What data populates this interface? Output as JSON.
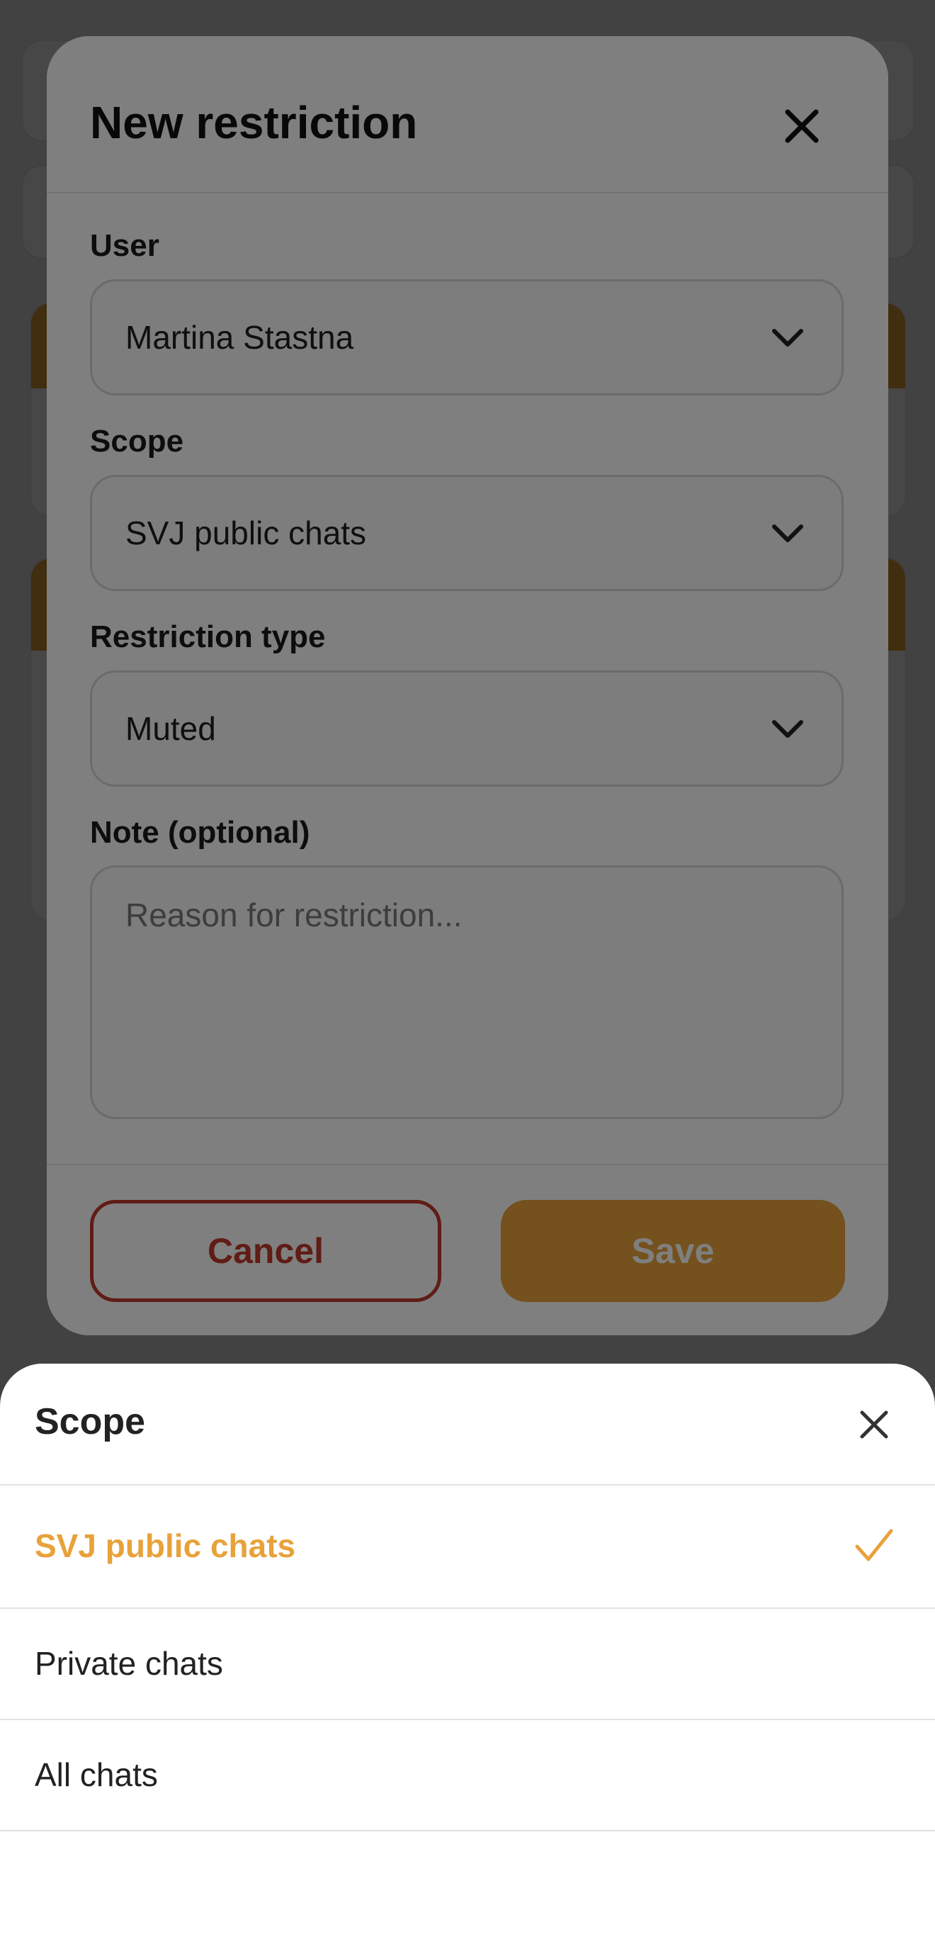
{
  "modal": {
    "title": "New restriction",
    "fields": {
      "user_label": "User",
      "user_value": "Martina Stastna",
      "scope_label": "Scope",
      "scope_value": "SVJ public chats",
      "type_label": "Restriction type",
      "type_value": "Muted",
      "note_label": "Note (optional)",
      "note_placeholder": "Reason for restriction..."
    },
    "buttons": {
      "cancel": "Cancel",
      "save": "Save"
    }
  },
  "sheet": {
    "title": "Scope",
    "options": [
      {
        "label": "SVJ public chats",
        "selected": true
      },
      {
        "label": "Private chats",
        "selected": false
      },
      {
        "label": "All chats",
        "selected": false
      }
    ]
  },
  "colors": {
    "accent": "#e8a23a",
    "danger": "#c0392b"
  },
  "icons": {
    "modal_close": "close-icon",
    "chevron": "chevron-down-icon",
    "sheet_close": "close-icon",
    "selected": "check-icon"
  }
}
